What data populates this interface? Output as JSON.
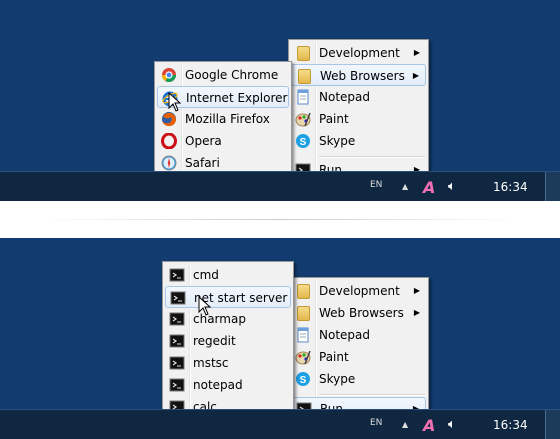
{
  "top": {
    "main_menu": [
      {
        "label": "Development",
        "icon": "folder-icon",
        "submenu": true
      },
      {
        "label": "Web Browsers",
        "icon": "folder-icon",
        "submenu": true,
        "highlighted": true
      },
      {
        "label": "Notepad",
        "icon": "notepad-icon"
      },
      {
        "label": "Paint",
        "icon": "paint-icon"
      },
      {
        "label": "Skype",
        "icon": "skype-icon"
      },
      {
        "label": "Run...",
        "icon": "terminal-icon",
        "submenu": true
      }
    ],
    "sub_menu": [
      {
        "label": "Google Chrome",
        "icon": "chrome-icon"
      },
      {
        "label": "Internet Explorer",
        "icon": "ie-icon",
        "highlighted": true
      },
      {
        "label": "Mozilla Firefox",
        "icon": "firefox-icon"
      },
      {
        "label": "Opera",
        "icon": "opera-icon"
      },
      {
        "label": "Safari",
        "icon": "safari-icon"
      }
    ],
    "taskbar": {
      "lang": "EN",
      "clock": "16:34"
    }
  },
  "bottom": {
    "main_menu": [
      {
        "label": "Development",
        "icon": "folder-icon",
        "submenu": true
      },
      {
        "label": "Web Browsers",
        "icon": "folder-icon",
        "submenu": true
      },
      {
        "label": "Notepad",
        "icon": "notepad-icon"
      },
      {
        "label": "Paint",
        "icon": "paint-icon"
      },
      {
        "label": "Skype",
        "icon": "skype-icon"
      },
      {
        "label": "Run...",
        "icon": "terminal-icon",
        "submenu": true,
        "highlighted": true
      }
    ],
    "sub_menu": [
      {
        "label": "cmd",
        "icon": "terminal-icon"
      },
      {
        "label": "net start server",
        "icon": "terminal-icon",
        "highlighted": true
      },
      {
        "label": "charmap",
        "icon": "terminal-icon"
      },
      {
        "label": "regedit",
        "icon": "terminal-icon"
      },
      {
        "label": "mstsc",
        "icon": "terminal-icon"
      },
      {
        "label": "notepad",
        "icon": "terminal-icon"
      },
      {
        "label": "calc",
        "icon": "terminal-icon"
      }
    ],
    "taskbar": {
      "lang": "EN",
      "clock": "16:34"
    }
  }
}
